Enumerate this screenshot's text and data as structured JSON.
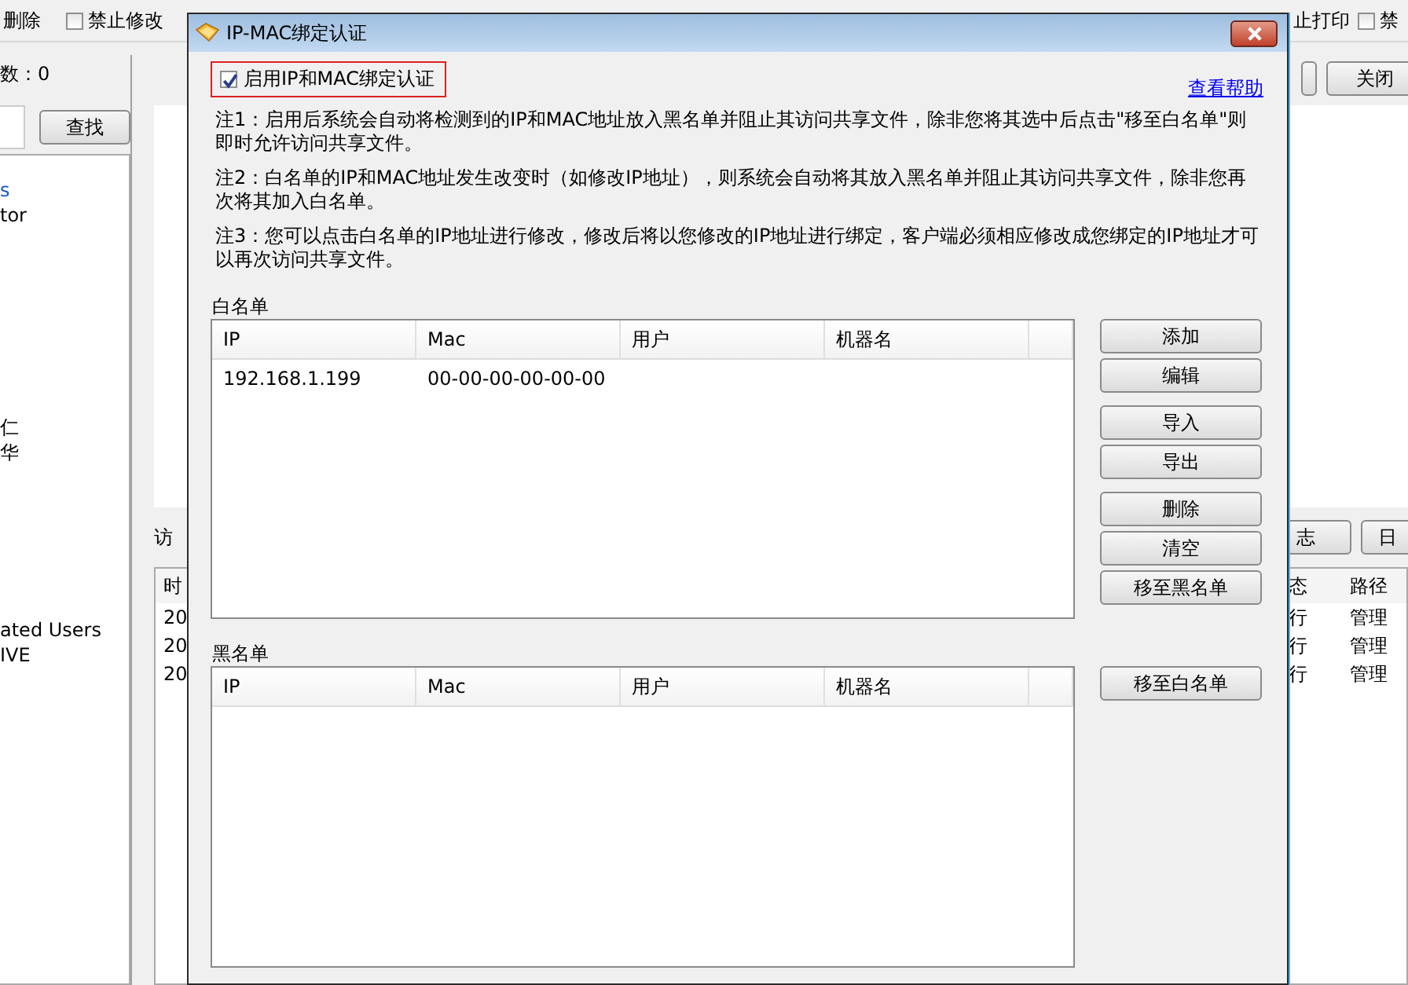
{
  "background": {
    "toolbar": [
      {
        "kind": "text",
        "label": "删除"
      },
      {
        "kind": "checkbox",
        "label": "禁止修改",
        "checked": false
      },
      {
        "kind": "text",
        "label": "止打印"
      },
      {
        "kind": "checkbox",
        "label": "禁",
        "checked": false
      }
    ],
    "count_label": "数：0",
    "search_button": "查找",
    "close_button": "关闭",
    "list_items": [
      "s",
      "tor",
      "仁",
      "华",
      "ated Users",
      "IVE"
    ],
    "log_label": "访",
    "log_buttons": [
      "志",
      "日"
    ],
    "log_columns": [
      "时",
      "态",
      "路径"
    ],
    "log_rows": [
      [
        "20",
        "行",
        "管理"
      ],
      [
        "20",
        "行",
        "管理"
      ],
      [
        "20",
        "行",
        "管理"
      ]
    ]
  },
  "dialog": {
    "title": "IP-MAC绑定认证",
    "enable": {
      "label": "启用IP和MAC绑定认证",
      "checked": true
    },
    "help_link": "查看帮助",
    "notes": [
      "注1：启用后系统会自动将检测到的IP和MAC地址放入黑名单并阻止其访问共享文件，除非您将其选中后点击\"移至白名单\"则即时允许访问共享文件。",
      "注2：白名单的IP和MAC地址发生改变时（如修改IP地址），则系统会自动将其放入黑名单并阻止其访问共享文件，除非您再次将其加入白名单。",
      "注3：您可以点击白名单的IP地址进行修改，修改后将以您修改的IP地址进行绑定，客户端必须相应修改成您绑定的IP地址才可以再次访问共享文件。"
    ],
    "whitelist": {
      "label": "白名单",
      "columns": [
        "IP",
        "Mac",
        "用户",
        "机器名"
      ],
      "rows": [
        [
          "192.168.1.199",
          "00-00-00-00-00-00",
          "",
          ""
        ]
      ],
      "button_groups": [
        [
          "添加",
          "编辑"
        ],
        [
          "导入",
          "导出"
        ],
        [
          "删除",
          "清空",
          "移至黑名单"
        ]
      ]
    },
    "blacklist": {
      "label": "黑名单",
      "columns": [
        "IP",
        "Mac",
        "用户",
        "机器名"
      ],
      "button_groups": [
        [
          "移至白名单"
        ]
      ]
    }
  }
}
